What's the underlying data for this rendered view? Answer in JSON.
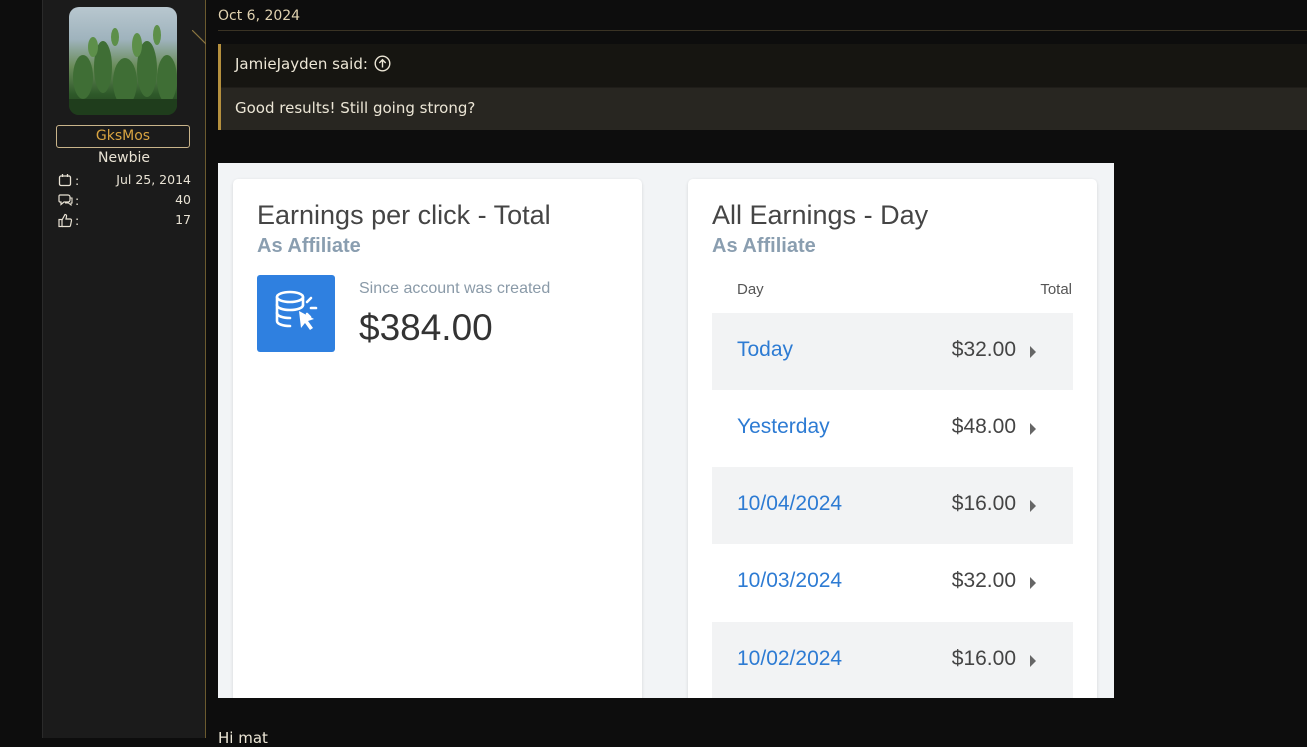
{
  "post": {
    "date": "Oct 6, 2024",
    "footer_text": "Hi mat"
  },
  "user": {
    "name": "GksMos",
    "title": "Newbie",
    "stats": [
      {
        "icon": "calendar-icon",
        "value": "Jul 25, 2014"
      },
      {
        "icon": "messages-icon",
        "value": "40"
      },
      {
        "icon": "thumbs-up-icon",
        "value": "17"
      }
    ],
    "colon": ":"
  },
  "quote": {
    "author_said": "JamieJayden said:",
    "text": "Good results! Still going strong?"
  },
  "embedded_screenshot": {
    "card1": {
      "title": "Earnings per click - Total",
      "subtitle": "As Affiliate",
      "icon": "database-click-icon",
      "since_label": "Since account was created",
      "amount": "$384.00"
    },
    "card2": {
      "title": "All Earnings - Day",
      "subtitle": "As Affiliate",
      "col_day": "Day",
      "col_total": "Total",
      "rows": [
        {
          "day": "Today",
          "total": "$32.00"
        },
        {
          "day": "Yesterday",
          "total": "$48.00"
        },
        {
          "day": "10/04/2024",
          "total": "$16.00"
        },
        {
          "day": "10/03/2024",
          "total": "$32.00"
        },
        {
          "day": "10/02/2024",
          "total": "$16.00"
        }
      ]
    }
  },
  "colors": {
    "accent_gold": "#d9a441",
    "link_blue": "#2d7bd3",
    "tile_blue": "#2f80e0"
  }
}
